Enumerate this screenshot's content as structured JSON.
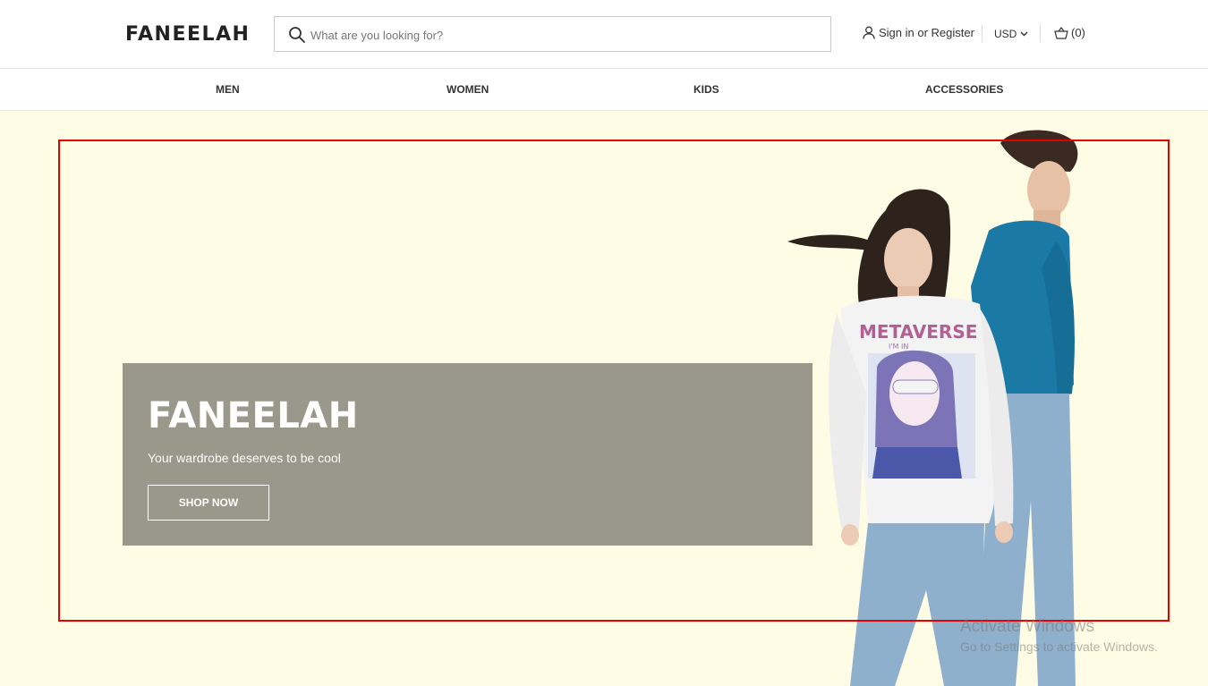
{
  "header": {
    "logo": "FANEELAH",
    "search_placeholder": "What are you looking for?",
    "account_label": "Sign in or Register",
    "currency": "USD",
    "cart_count": "(0)"
  },
  "nav": {
    "items": [
      "MEN",
      "WOMEN",
      "KIDS",
      "ACCESSORIES"
    ]
  },
  "hero": {
    "title": "FANEELAH",
    "subtitle": "Your wardrobe deserves to be cool",
    "button_label": "SHOP NOW",
    "image_sweatshirt_text": "METAVERSE",
    "image_sweatshirt_subtext": "I'M IN"
  },
  "watermark": {
    "title": "Activate Windows",
    "subtitle": "Go to Settings to activate Windows."
  },
  "colors": {
    "page_background": "#fffce6",
    "hero_card": "#9a988a",
    "frame": "#e60000"
  },
  "icons": {
    "search": "search-icon",
    "user": "user-icon",
    "chevron": "chevron-down-icon",
    "cart": "cart-icon"
  }
}
